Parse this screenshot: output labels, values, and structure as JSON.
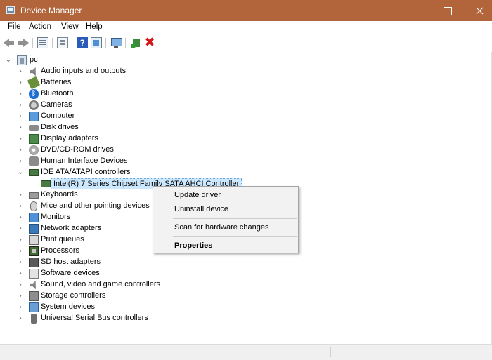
{
  "window": {
    "title": "Device Manager",
    "titlebar_color": "#b2643b"
  },
  "menu": {
    "items": [
      "File",
      "Action",
      "View",
      "Help"
    ]
  },
  "toolbar": {
    "icons": [
      "back-arrow-icon",
      "forward-arrow-icon",
      "properties-icon",
      "list-icon",
      "help-icon",
      "view-icon",
      "scan-monitor-icon",
      "add-driver-icon",
      "uninstall-x-icon"
    ]
  },
  "tree": {
    "root_label": "pc",
    "categories": [
      {
        "label": "Audio inputs and outputs",
        "icon": "speaker-icon"
      },
      {
        "label": "Batteries",
        "icon": "battery-icon"
      },
      {
        "label": "Bluetooth",
        "icon": "bluetooth-icon"
      },
      {
        "label": "Cameras",
        "icon": "camera-icon"
      },
      {
        "label": "Computer",
        "icon": "computer-icon"
      },
      {
        "label": "Disk drives",
        "icon": "disk-drive-icon"
      },
      {
        "label": "Display adapters",
        "icon": "display-adapter-icon"
      },
      {
        "label": "DVD/CD-ROM drives",
        "icon": "dvd-icon"
      },
      {
        "label": "Human Interface Devices",
        "icon": "hid-icon"
      },
      {
        "label": "IDE ATA/ATAPI controllers",
        "icon": "ide-controller-icon",
        "expanded": true
      },
      {
        "label": "Keyboards",
        "icon": "keyboard-icon"
      },
      {
        "label": "Mice and other pointing devices",
        "icon": "mouse-icon"
      },
      {
        "label": "Monitors",
        "icon": "monitor-icon"
      },
      {
        "label": "Network adapters",
        "icon": "network-adapter-icon"
      },
      {
        "label": "Print queues",
        "icon": "printer-icon"
      },
      {
        "label": "Processors",
        "icon": "processor-icon"
      },
      {
        "label": "SD host adapters",
        "icon": "sd-card-icon"
      },
      {
        "label": "Software devices",
        "icon": "software-device-icon"
      },
      {
        "label": "Sound, video and game controllers",
        "icon": "sound-icon"
      },
      {
        "label": "Storage controllers",
        "icon": "storage-controller-icon"
      },
      {
        "label": "System devices",
        "icon": "system-devices-icon"
      },
      {
        "label": "Universal Serial Bus controllers",
        "icon": "usb-icon"
      }
    ],
    "selected_child": {
      "label": "Intel(R) 7 Series Chipset Family SATA AHCI Controller",
      "icon": "ide-controller-icon"
    }
  },
  "context_menu": {
    "items": [
      "Update driver",
      "Uninstall device",
      "Scan for hardware changes",
      "Properties"
    ]
  }
}
